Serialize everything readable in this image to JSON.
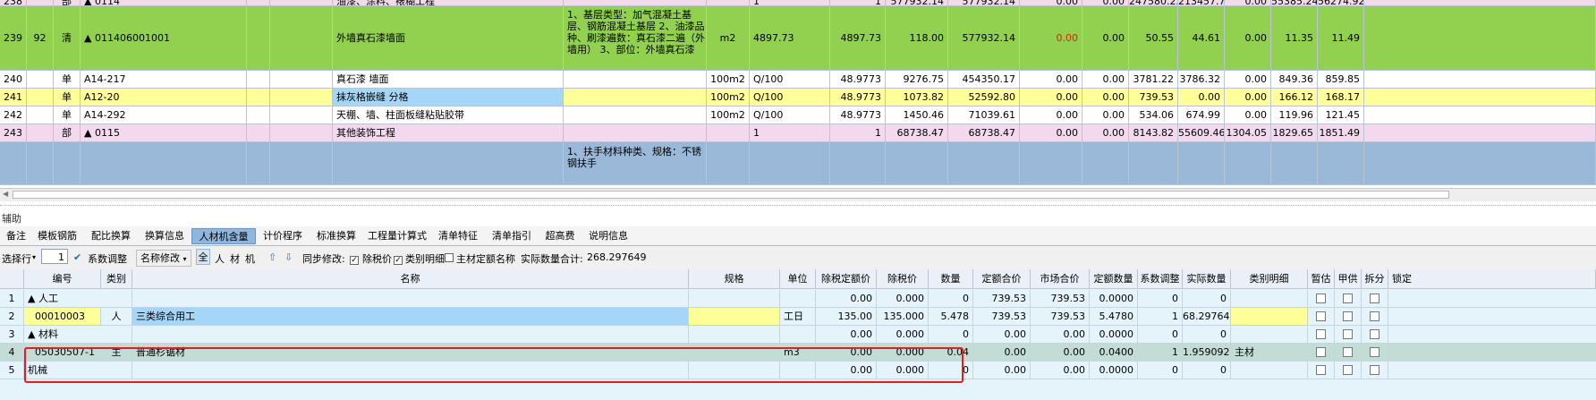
{
  "top_table": {
    "rows": [
      {
        "no": "238",
        "seq": "",
        "type": "部",
        "code": "▲ 0114",
        "name": "油漆、涂料、裱糊工程",
        "feature": "",
        "unit": "",
        "qty_expr": "1",
        "qty": "1",
        "price": "577932.14",
        "total": "577932.14",
        "c1": "0.00",
        "c2": "0.00",
        "c3": "247580.23",
        "c4": "213457.74",
        "c5": "0.00",
        "c6": "55385.24",
        "c7": "56274.92",
        "bg": "#f2d9ee"
      },
      {
        "no": "239",
        "seq": "92",
        "type": "清",
        "code": "▲ 011406001001",
        "name": "外墙真石漆墙面",
        "feature": "1、基层类型：加气混凝土基层、钢筋混凝土基层\n2、油漆品种、刷漆遍数：真石漆二遍（外墙用）\n3、部位：外墙真石漆",
        "unit": "m2",
        "qty_expr": "4897.73",
        "qty": "4897.73",
        "price": "118.00",
        "total": "577932.14",
        "c1": "0.00",
        "c2": "0.00",
        "c3": "50.55",
        "c4": "44.61",
        "c5": "0.00",
        "c6": "11.35",
        "c7": "11.49",
        "bg": "#92d050",
        "c1_red": true
      },
      {
        "no": "240",
        "seq": "",
        "type": "单",
        "code": "A14-217",
        "name": "真石漆 墙面",
        "feature": "",
        "unit": "100m2",
        "qty_expr": "Q/100",
        "qty": "48.9773",
        "price": "9276.75",
        "total": "454350.17",
        "c1": "0.00",
        "c2": "0.00",
        "c3": "3781.22",
        "c4": "3786.32",
        "c5": "0.00",
        "c6": "849.36",
        "c7": "859.85",
        "bg": "#ffffff"
      },
      {
        "no": "241",
        "seq": "",
        "type": "单",
        "code": "A12-20",
        "name": "抹灰格嵌缝 分格",
        "feature": "",
        "unit": "100m2",
        "qty_expr": "Q/100",
        "qty": "48.9773",
        "price": "1073.82",
        "total": "52592.80",
        "c1": "0.00",
        "c2": "0.00",
        "c3": "739.53",
        "c4": "0.00",
        "c5": "0.00",
        "c6": "166.12",
        "c7": "168.17",
        "bg": "#ffff99",
        "name_bg": "#a6d6f7"
      },
      {
        "no": "242",
        "seq": "",
        "type": "单",
        "code": "A14-292",
        "name": "天棚、墙、柱面板缝粘贴胶带",
        "feature": "",
        "unit": "100m2",
        "qty_expr": "Q/100",
        "qty": "48.9773",
        "price": "1450.46",
        "total": "71039.61",
        "c1": "0.00",
        "c2": "0.00",
        "c3": "534.06",
        "c4": "674.99",
        "c5": "0.00",
        "c6": "119.96",
        "c7": "121.45",
        "bg": "#ffffff"
      },
      {
        "no": "243",
        "seq": "",
        "type": "部",
        "code": "▲ 0115",
        "name": "其他装饰工程",
        "feature": "",
        "unit": "",
        "qty_expr": "1",
        "qty": "1",
        "price": "68738.47",
        "total": "68738.47",
        "c1": "0.00",
        "c2": "0.00",
        "c3": "8143.82",
        "c4": "55609.46",
        "c5": "1304.05",
        "c6": "1829.65",
        "c7": "1851.49",
        "bg": "#f2d9ee"
      },
      {
        "no": "",
        "seq": "",
        "type": "",
        "code": "",
        "name": "",
        "feature": "1、扶手材料种类、规格：不锈钢扶手",
        "unit": "",
        "qty_expr": "",
        "qty": "",
        "price": "",
        "total": "",
        "c1": "",
        "c2": "",
        "c3": "",
        "c4": "",
        "c5": "",
        "c6": "",
        "c7": "",
        "bg": "#9ab8d8"
      }
    ]
  },
  "aux": {
    "title": "辅助",
    "tabs": [
      "备注",
      "模板钢筋",
      "配比换算",
      "换算信息",
      "人材机含量",
      "计价程序",
      "标准换算",
      "工程量计算式",
      "清单特征",
      "清单指引",
      "超高费",
      "说明信息"
    ],
    "active_tab": 4
  },
  "toolbar": {
    "select_row_label": "选择行",
    "select_row_value": "1",
    "coef_adjust": "系数调整",
    "name_modify": "名称修改",
    "filters": [
      "全",
      "人",
      "材",
      "机"
    ],
    "sync_modify": "同步修改:",
    "chk_tax_price": "除税价",
    "chk_category": "类别明细",
    "chk_main_quota": "主材定额名称",
    "actual_total_label": "实际数量合计:",
    "actual_total_value": "268.297649"
  },
  "bottom_table": {
    "headers": [
      "",
      "编号",
      "类别",
      "名称",
      "规格",
      "单位",
      "除税定额价",
      "除税价",
      "数量",
      "定额合价",
      "市场合价",
      "定额数量",
      "系数调整",
      "实际数量",
      "类别明细",
      "暂估",
      "甲供",
      "拆分",
      "锁定"
    ],
    "rows": [
      {
        "no": "1",
        "code": "▲ 人工",
        "cat": "",
        "name": "",
        "spec": "",
        "unit": "",
        "p1": "0.00",
        "p2": "0.000",
        "qty": "0",
        "t1": "739.53",
        "t2": "739.53",
        "dq": "0.0000",
        "coef": "0",
        "aq": "0",
        "catd": "",
        "group": true
      },
      {
        "no": "2",
        "code": "00010003",
        "cat": "人",
        "name": "三类综合用工",
        "spec": "",
        "unit": "工日",
        "p1": "135.00",
        "p2": "135.000",
        "qty": "5.478",
        "t1": "739.53",
        "t2": "739.53",
        "dq": "5.4780",
        "coef": "1",
        "aq": "68.297649",
        "catd": "",
        "yellow": true
      },
      {
        "no": "3",
        "code": "▲ 材料",
        "cat": "",
        "name": "",
        "spec": "",
        "unit": "",
        "p1": "0.00",
        "p2": "0.000",
        "qty": "0",
        "t1": "0.00",
        "t2": "0.00",
        "dq": "0.0000",
        "coef": "0",
        "aq": "0",
        "catd": "",
        "group": true
      },
      {
        "no": "4",
        "code": "05030507-1",
        "cat": "主",
        "name": "普通杉锯材",
        "spec": "",
        "unit": "m3",
        "p1": "0.00",
        "p2": "0.000",
        "qty": "0.04",
        "t1": "0.00",
        "t2": "0.00",
        "dq": "0.0400",
        "coef": "1",
        "aq": "1.959092",
        "catd": "主材",
        "selected": true
      },
      {
        "no": "5",
        "code": "机械",
        "cat": "",
        "name": "",
        "spec": "",
        "unit": "",
        "p1": "0.00",
        "p2": "0.000",
        "qty": "0",
        "t1": "0.00",
        "t2": "0.00",
        "dq": "0.0000",
        "coef": "0",
        "aq": "0",
        "catd": "",
        "group": true
      }
    ]
  },
  "colors": {
    "green": "#92d050",
    "pink": "#f2d9ee",
    "yellow": "#ffff99",
    "light_blue": "#e5f3fb",
    "selected": "#c4dcd6",
    "highlight": "#e02020"
  }
}
